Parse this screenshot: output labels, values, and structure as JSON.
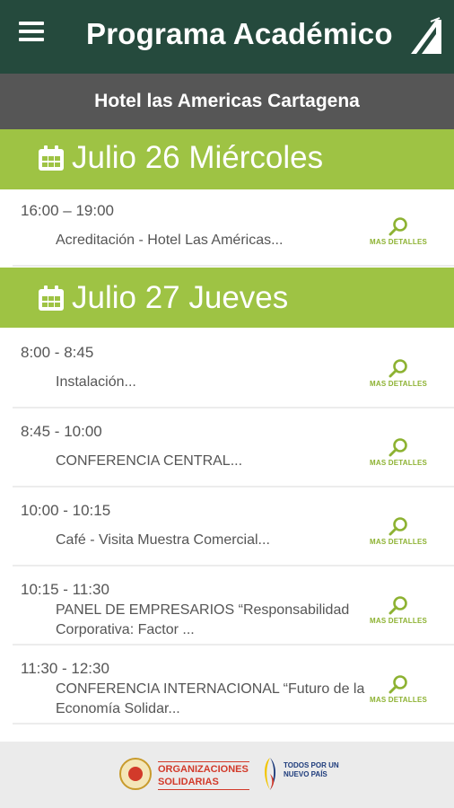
{
  "header": {
    "title": "Programa Académico",
    "menu_icon": "hamburger-menu-icon",
    "logo_icon": "event-logo-icon",
    "background": "#254a3d"
  },
  "venue": {
    "name": "Hotel las Americas Cartagena"
  },
  "colors": {
    "accent": "#9ec344",
    "link": "#8db232",
    "venue_bar": "#565656"
  },
  "days": [
    {
      "title": "Julio 26 Miércoles",
      "icon": "calendar-icon",
      "events": [
        {
          "time": "16:00 – 19:00",
          "description": "Acreditación - Hotel Las Américas...",
          "details_label": "MAS DETALLES"
        }
      ]
    },
    {
      "title": "Julio 27 Jueves",
      "icon": "calendar-icon",
      "events": [
        {
          "time": "8:00 - 8:45",
          "description": "Instalación...",
          "details_label": "MAS DETALLES"
        },
        {
          "time": "8:45 - 10:00",
          "description": "CONFERENCIA CENTRAL...",
          "details_label": "MAS DETALLES"
        },
        {
          "time": "10:00 - 10:15",
          "description": "Café - Visita Muestra Comercial...",
          "details_label": "MAS DETALLES"
        },
        {
          "time": "10:15 - 11:30",
          "description": "PANEL DE EMPRESARIOS “Responsabilidad Corporativa: Factor ...",
          "details_label": "MAS DETALLES"
        },
        {
          "time": "11:30 - 12:30",
          "description": "CONFERENCIA  INTERNACIONAL “Futuro de la Economía Solidar...",
          "details_label": "MAS DETALLES"
        }
      ]
    }
  ],
  "footer": {
    "org_name": "ORGANIZACIONES SOLIDARIAS",
    "gov_name": "TODOS POR UN NUEVO PAÍS"
  }
}
